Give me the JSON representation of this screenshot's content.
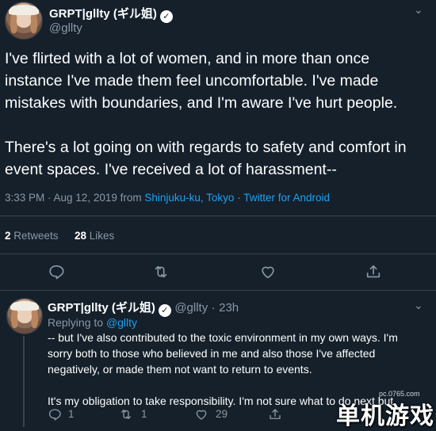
{
  "main_tweet": {
    "author_name": "GRPT|gllty (ギル姐)",
    "author_handle": "@gllty",
    "paragraph_1": "I've flirted with a lot of women, and in more than once instance I've made them feel uncomfortable. I've made mistakes with boundaries, and I'm aware I've hurt people.",
    "paragraph_2": "There's a lot going on with regards to safety and comfort in event spaces. I've received a lot of harassment--",
    "timestamp": "3:33 PM · Aug 12, 2019 from",
    "location": "Shinjuku-ku, Tokyo",
    "separator": "·",
    "source": "Twitter for Android",
    "retweets_count": "2",
    "retweets_label": "Retweets",
    "likes_count": "28",
    "likes_label": "Likes"
  },
  "reply_tweet": {
    "author_name": "GRPT|gllty (ギル姐)",
    "author_handle": "@gllty",
    "time_sep": "·",
    "time": "23h",
    "replying_label": "Replying to",
    "replying_handle": "@gllty",
    "paragraph_1": "-- but I've also contributed to the toxic environment in my own ways. I'm sorry both to those who believed in me and also those I've affected negatively, or made them not want to return to events.",
    "paragraph_2": "It's my obligation to take responsibility. I'm not sure what to do next but",
    "reply_count": "1",
    "retweet_count": "1",
    "like_count": "29"
  },
  "watermark": {
    "small": "pc.0765.com",
    "large": "单机游戏"
  },
  "colors": {
    "background": "#15202b",
    "text": "#ffffff",
    "secondary": "#8899a6",
    "link": "#1da1f2",
    "divider": "#38444d"
  },
  "icons": [
    "verified-icon",
    "chevron-down-icon",
    "reply-icon",
    "retweet-icon",
    "like-icon",
    "share-icon"
  ]
}
